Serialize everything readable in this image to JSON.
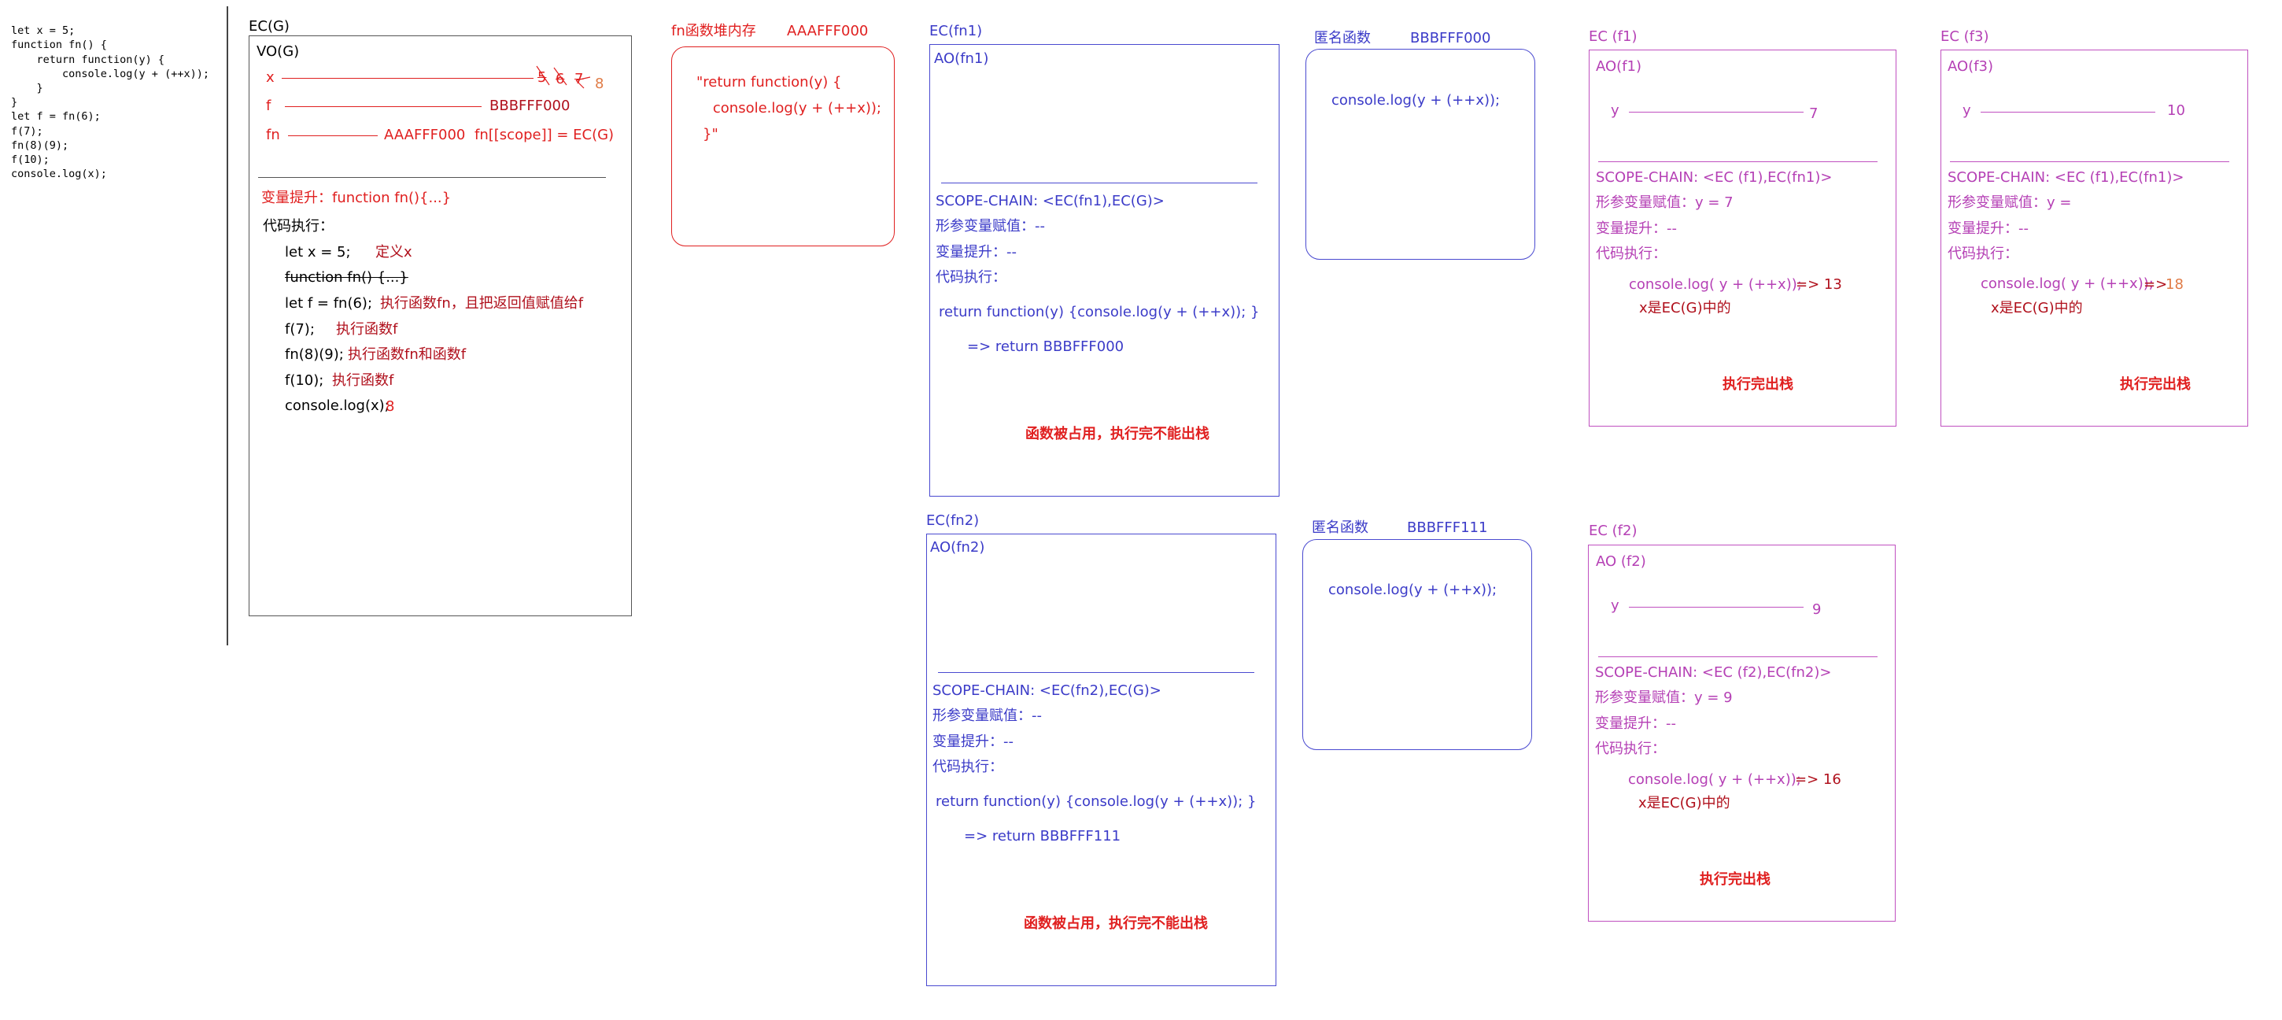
{
  "source_code": [
    "let x = 5;",
    "function fn() {",
    "    return function(y) {",
    "        console.log(y + (++x));",
    "    }",
    "}",
    "let f = fn(6);",
    "f(7);",
    "fn(8)(9);",
    "f(10);",
    "console.log(x);"
  ],
  "ecg": {
    "title": "EC(G)",
    "vo": "VO(G)",
    "x_label": "x",
    "x_values": [
      "5",
      "6",
      "7",
      "8"
    ],
    "f_label": "f",
    "f_value": "BBBFFF000",
    "fn_label": "fn",
    "fn_value": "AAAFFF000",
    "fn_scope": "fn[[scope]] = EC(G)",
    "hoisting": "变量提升：function fn(){...}",
    "exec_title": "代码执行：",
    "lines": [
      {
        "code": "let x = 5;",
        "note": "定义x"
      },
      {
        "code": "function fn() {...}",
        "note": ""
      },
      {
        "code": "let f = fn(6);",
        "note": "执行函数fn，且把返回值赋值给f"
      },
      {
        "code": "f(7);",
        "note": "执行函数f"
      },
      {
        "code": "fn(8)(9);",
        "note": "执行函数fn和函数f"
      },
      {
        "code": "f(10);",
        "note": "执行函数f"
      },
      {
        "code": "console.log(x);",
        "note": "8"
      }
    ]
  },
  "heap_fn": {
    "title": "fn函数堆内存",
    "address": "AAAFFF000",
    "code": [
      "\"return function(y) {",
      "    console.log(y + (++x));",
      "}\""
    ]
  },
  "ec_fn1": {
    "title": "EC(fn1)",
    "ao": "AO(fn1)",
    "scope_chain": "SCOPE-CHAIN: <EC(fn1),EC(G)>",
    "params": "形参变量赋值：--",
    "hoisting": "变量提升：--",
    "exec": "代码执行：",
    "return_code": "return function(y) {console.log(y + (++x)); }",
    "return_result": "=> return BBBFFF000",
    "note": "函数被占用，执行完不能出栈"
  },
  "ec_fn2": {
    "title": "EC(fn2)",
    "ao": "AO(fn2)",
    "scope_chain": "SCOPE-CHAIN: <EC(fn2),EC(G)>",
    "params": "形参变量赋值：--",
    "hoisting": "变量提升：--",
    "exec": "代码执行：",
    "return_code": "return function(y) {console.log(y + (++x)); }",
    "return_result": "=> return BBBFFF111",
    "note": "函数被占用，执行完不能出栈"
  },
  "anon1": {
    "title": "匿名函数",
    "address": "BBBFFF000",
    "code": "console.log(y + (++x));"
  },
  "anon2": {
    "title": "匿名函数",
    "address": "BBBFFF111",
    "code": "console.log(y + (++x));"
  },
  "ec_f1": {
    "title": "EC (f1)",
    "ao": "AO(f1)",
    "y_label": "y",
    "y_value": "7",
    "scope_chain": "SCOPE-CHAIN: <EC (f1),EC(fn1)>",
    "params": "形参变量赋值：y = 7",
    "hoisting": "变量提升：--",
    "exec": "代码执行：",
    "log_code": "console.log( y + (++x));",
    "log_result": "=> 13",
    "x_note": "x是EC(G)中的",
    "done": "执行完出栈"
  },
  "ec_f2": {
    "title": "EC (f2)",
    "ao": "AO (f2)",
    "y_label": "y",
    "y_value": "9",
    "scope_chain": "SCOPE-CHAIN: <EC (f2),EC(fn2)>",
    "params": "形参变量赋值：y = 9",
    "hoisting": "变量提升：--",
    "exec": "代码执行：",
    "log_code": "console.log( y + (++x));",
    "log_result": "=> 16",
    "x_note": "x是EC(G)中的",
    "done": "执行完出栈"
  },
  "ec_f3": {
    "title": "EC (f3)",
    "ao": "AO(f3)",
    "y_label": "y",
    "y_value": "10",
    "scope_chain": "SCOPE-CHAIN: <EC (f1),EC(fn1)>",
    "params": "形参变量赋值：y =",
    "hoisting": "变量提升：--",
    "exec": "代码执行：",
    "log_code": "console.log( y + (++x));",
    "log_result_arrow": "=>",
    "log_result": "18",
    "x_note": "x是EC(G)中的",
    "done": "执行完出栈"
  },
  "colors": {
    "red": "#e02020",
    "dark_red": "#b0101c",
    "blue": "#3b3bc8",
    "purple": "#b540b5",
    "dark_purple": "#8e1f8e",
    "orange": "#e07b46"
  }
}
